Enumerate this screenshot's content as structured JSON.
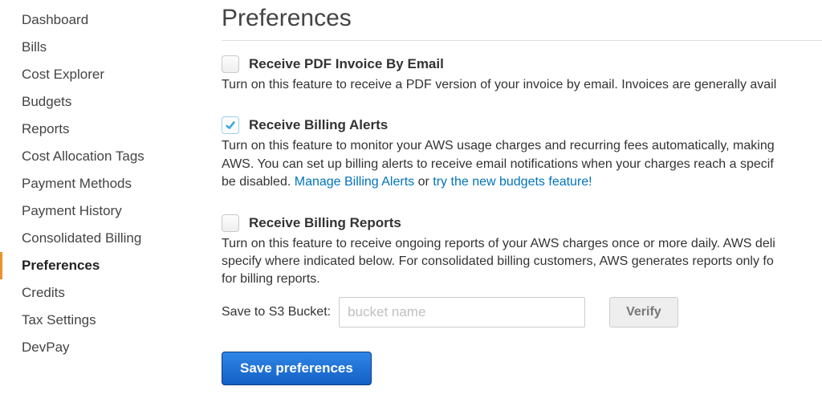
{
  "sidebar": {
    "items": [
      {
        "label": "Dashboard",
        "active": false
      },
      {
        "label": "Bills",
        "active": false
      },
      {
        "label": "Cost Explorer",
        "active": false
      },
      {
        "label": "Budgets",
        "active": false
      },
      {
        "label": "Reports",
        "active": false
      },
      {
        "label": "Cost Allocation Tags",
        "active": false
      },
      {
        "label": "Payment Methods",
        "active": false
      },
      {
        "label": "Payment History",
        "active": false
      },
      {
        "label": "Consolidated Billing",
        "active": false
      },
      {
        "label": "Preferences",
        "active": true
      },
      {
        "label": "Credits",
        "active": false
      },
      {
        "label": "Tax Settings",
        "active": false
      },
      {
        "label": "DevPay",
        "active": false
      }
    ]
  },
  "page": {
    "title": "Preferences"
  },
  "prefs": {
    "pdf_invoice": {
      "checked": false,
      "label": "Receive PDF Invoice By Email",
      "desc": "Turn on this feature to receive a PDF version of your invoice by email. Invoices are generally avail"
    },
    "billing_alerts": {
      "checked": true,
      "label": "Receive Billing Alerts",
      "desc_line1": "Turn on this feature to monitor your AWS usage charges and recurring fees automatically, making",
      "desc_line2": "AWS. You can set up billing alerts to receive email notifications when your charges reach a specif",
      "desc_line3_pre": "be disabled. ",
      "link1": "Manage Billing Alerts",
      "desc_line3_mid": " or ",
      "link2": "try the new budgets feature!"
    },
    "billing_reports": {
      "checked": false,
      "label": "Receive Billing Reports",
      "desc_line1": "Turn on this feature to receive ongoing reports of your AWS charges once or more daily. AWS deli",
      "desc_line2": "specify where indicated below. For consolidated billing customers, AWS generates reports only fo",
      "desc_line3": "for billing reports."
    }
  },
  "s3": {
    "label": "Save to S3 Bucket:",
    "placeholder": "bucket name",
    "value": "",
    "verify": "Verify"
  },
  "save_button": "Save preferences"
}
